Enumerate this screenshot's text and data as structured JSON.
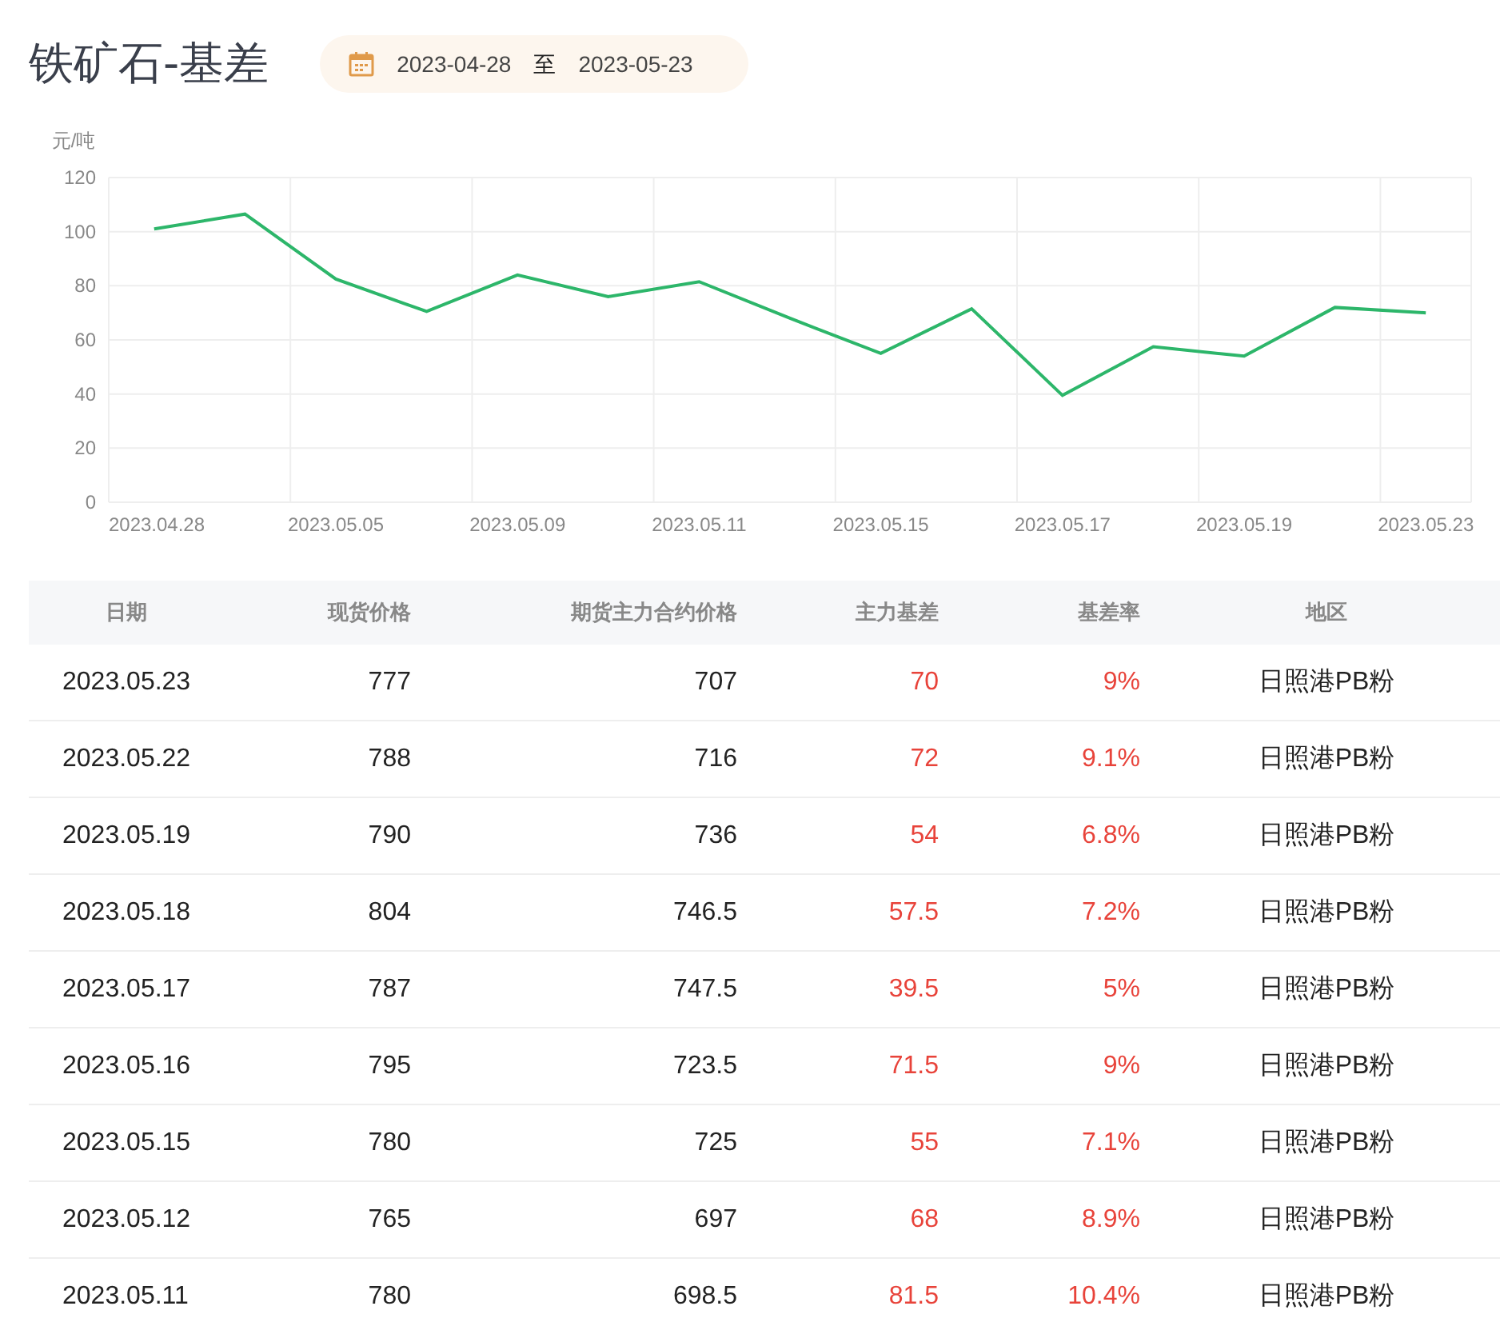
{
  "title": "铁矿石-基差",
  "date_range": {
    "start": "2023-04-28",
    "separator": "至",
    "end": "2023-05-23"
  },
  "chart": {
    "chart_data": {
      "type": "line",
      "ylabel": "元/吨",
      "grid": true,
      "categories": [
        "2023.04.28",
        null,
        "2023.05.05",
        null,
        "2023.05.09",
        null,
        "2023.05.11",
        null,
        "2023.05.15",
        null,
        "2023.05.17",
        null,
        "2023.05.19",
        null,
        "2023.05.23"
      ],
      "series": [
        {
          "color": "#2db66a",
          "values": [
            101,
            106.5,
            82.5,
            70.5,
            84,
            76,
            81.5,
            68,
            55,
            71.5,
            39.5,
            57.5,
            54,
            72,
            70
          ]
        }
      ],
      "ylim": [
        0,
        120
      ],
      "yticks": [
        0,
        20,
        40,
        60,
        80,
        100,
        120
      ]
    }
  },
  "table": {
    "columns": [
      "日期",
      "现货价格",
      "期货主力合约价格",
      "主力基差",
      "基差率",
      "地区"
    ],
    "rows": [
      [
        "2023.05.23",
        "777",
        "707",
        "70",
        "9%",
        "日照港PB粉"
      ],
      [
        "2023.05.22",
        "788",
        "716",
        "72",
        "9.1%",
        "日照港PB粉"
      ],
      [
        "2023.05.19",
        "790",
        "736",
        "54",
        "6.8%",
        "日照港PB粉"
      ],
      [
        "2023.05.18",
        "804",
        "746.5",
        "57.5",
        "7.2%",
        "日照港PB粉"
      ],
      [
        "2023.05.17",
        "787",
        "747.5",
        "39.5",
        "5%",
        "日照港PB粉"
      ],
      [
        "2023.05.16",
        "795",
        "723.5",
        "71.5",
        "9%",
        "日照港PB粉"
      ],
      [
        "2023.05.15",
        "780",
        "725",
        "55",
        "7.1%",
        "日照港PB粉"
      ],
      [
        "2023.05.12",
        "765",
        "697",
        "68",
        "8.9%",
        "日照港PB粉"
      ],
      [
        "2023.05.11",
        "780",
        "698.5",
        "81.5",
        "10.4%",
        "日照港PB粉"
      ]
    ]
  }
}
